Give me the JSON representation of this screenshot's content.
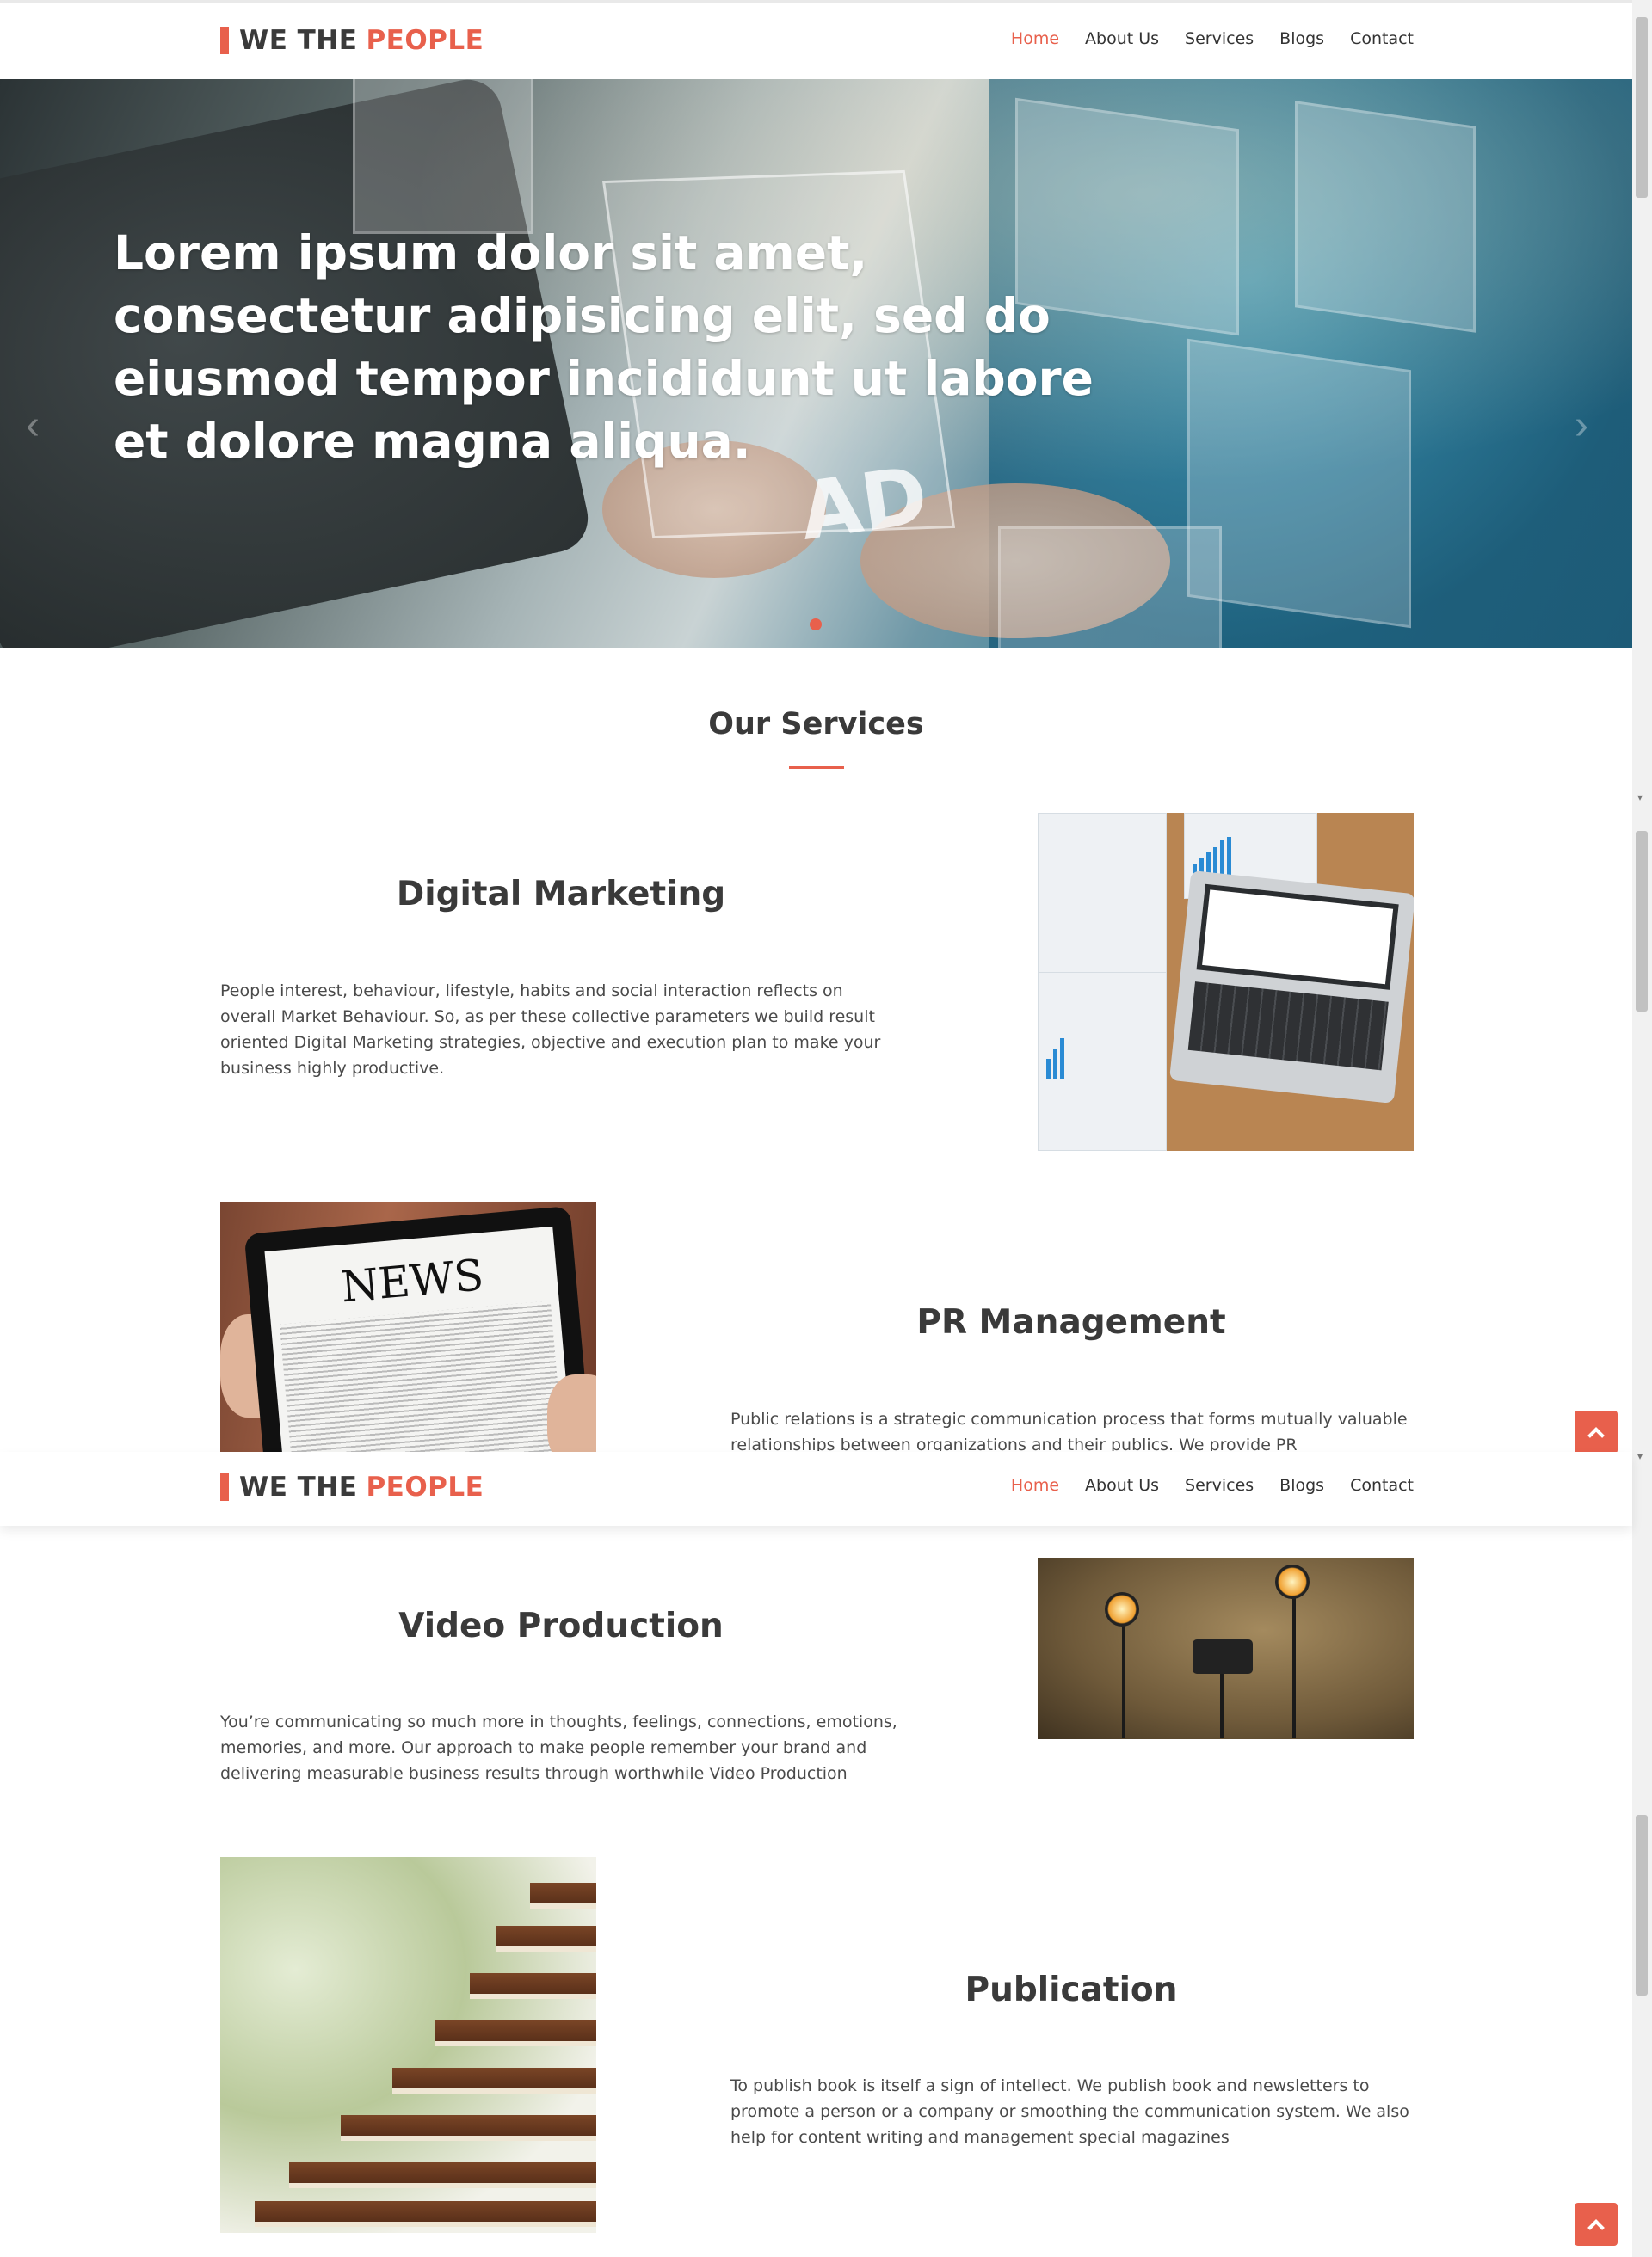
{
  "site": {
    "brand_main": "WE THE",
    "brand_accent": "PEOPLE"
  },
  "nav": {
    "items": [
      "Home",
      "About Us",
      "Services",
      "Blogs",
      "Contact"
    ],
    "active": "Home"
  },
  "hero": {
    "title": "Lorem ipsum dolor sit amet, consectetur adipisicing elit, sed do eiusmod tempor incididunt ut labore et dolore magna aliqua.",
    "overlay_text": "AD",
    "prev_icon": "chevron-left-icon",
    "next_icon": "chevron-right-icon"
  },
  "services": {
    "title": "Our Services",
    "items": [
      {
        "heading": "Digital Marketing",
        "text": "People interest, behaviour, lifestyle, habits and social interaction reflects on overall Market Behaviour. So, as per these collective parameters we build result oriented Digital Marketing strategies, objective and execution plan to make your business highly productive."
      },
      {
        "heading": "PR Management",
        "text": "Public relations is a strategic communication process that forms mutually valuable relationships between organizations and their publics. We provide PR Management,",
        "image_text": "NEWS"
      },
      {
        "heading": "Video Production",
        "text": "You’re communicating so much more in thoughts, feelings, connections, emotions, memories, and more. Our approach to make people remember your brand and delivering measurable business results through worthwhile Video Production"
      },
      {
        "heading": "Publication",
        "text": "To publish book is itself a sign of intellect. We publish book and newsletters to promote a person or a company or smoothing the communication system. We also help for content writing and management special magazines"
      }
    ]
  },
  "colors": {
    "accent": "#e8604c",
    "text": "#3a3a3a"
  },
  "icons": {
    "scroll_top": "chevron-up-icon"
  }
}
